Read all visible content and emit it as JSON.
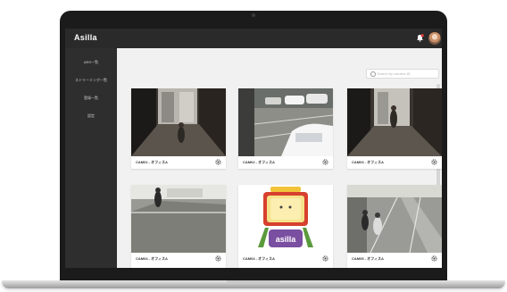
{
  "app": {
    "title": "Asilla"
  },
  "header": {
    "bell_icon": "bell-icon",
    "avatar": "avatar"
  },
  "sidebar": {
    "items": [
      {
        "label": "ARS一覧"
      },
      {
        "label": "ストリーミング一覧"
      },
      {
        "label": "登録一覧"
      },
      {
        "label": "設定"
      }
    ]
  },
  "search": {
    "placeholder": "Search by camera ID"
  },
  "cameras": [
    {
      "label": "CAM01 - オフィスA",
      "scene": "indoor-corridor"
    },
    {
      "label": "CAM02 - オフィスA",
      "scene": "parking-lot"
    },
    {
      "label": "CAM03 - オフィスA",
      "scene": "indoor-corridor"
    },
    {
      "label": "CAM04 - オフィスA",
      "scene": "rooftop"
    },
    {
      "label": "CAM04 - オフィスA",
      "scene": "asilla-logo"
    },
    {
      "label": "CAM05 - オフィスA",
      "scene": "street"
    }
  ],
  "logo_text": "asilla",
  "colors": {
    "topbar": "#2a2a2a",
    "sidebar": "#2e2e2e",
    "background": "#f1f1f1",
    "bell": "#e23b3b"
  }
}
